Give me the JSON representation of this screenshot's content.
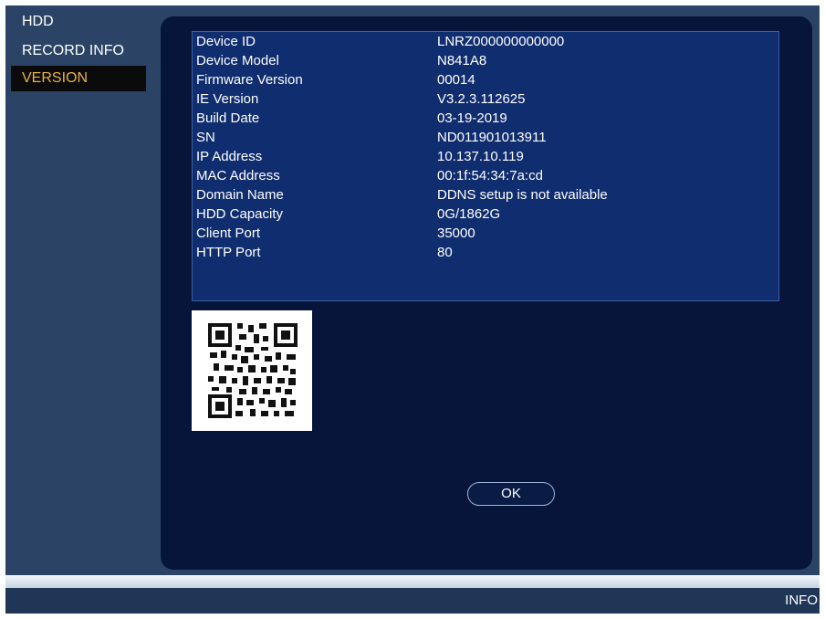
{
  "sidebar": {
    "items": [
      {
        "label": "HDD"
      },
      {
        "label": "RECORD INFO"
      },
      {
        "label": "VERSION",
        "selected": true
      }
    ]
  },
  "info": {
    "rows": [
      {
        "label": "Device ID",
        "value": "LNRZ000000000000"
      },
      {
        "label": "Device Model",
        "value": "N841A8"
      },
      {
        "label": "Firmware Version",
        "value": "00014"
      },
      {
        "label": "IE Version",
        "value": "V3.2.3.112625"
      },
      {
        "label": "Build Date",
        "value": "03-19-2019"
      },
      {
        "label": "SN",
        "value": "ND011901013911"
      },
      {
        "label": "IP Address",
        "value": "10.137.10.119"
      },
      {
        "label": "MAC Address",
        "value": "00:1f:54:34:7a:cd"
      },
      {
        "label": "Domain Name",
        "value": "DDNS setup is not available"
      },
      {
        "label": "HDD Capacity",
        "value": "0G/1862G"
      },
      {
        "label": "Client Port",
        "value": "35000"
      },
      {
        "label": "HTTP Port",
        "value": "80"
      }
    ]
  },
  "buttons": {
    "ok_label": "OK"
  },
  "bottom": {
    "label": "INFO"
  },
  "colors": {
    "background": "#2b4466",
    "panel": "#07153b",
    "info_box": "#0f2d6f",
    "selected_text": "#e7b341",
    "selected_bg": "#0b0b0b"
  }
}
